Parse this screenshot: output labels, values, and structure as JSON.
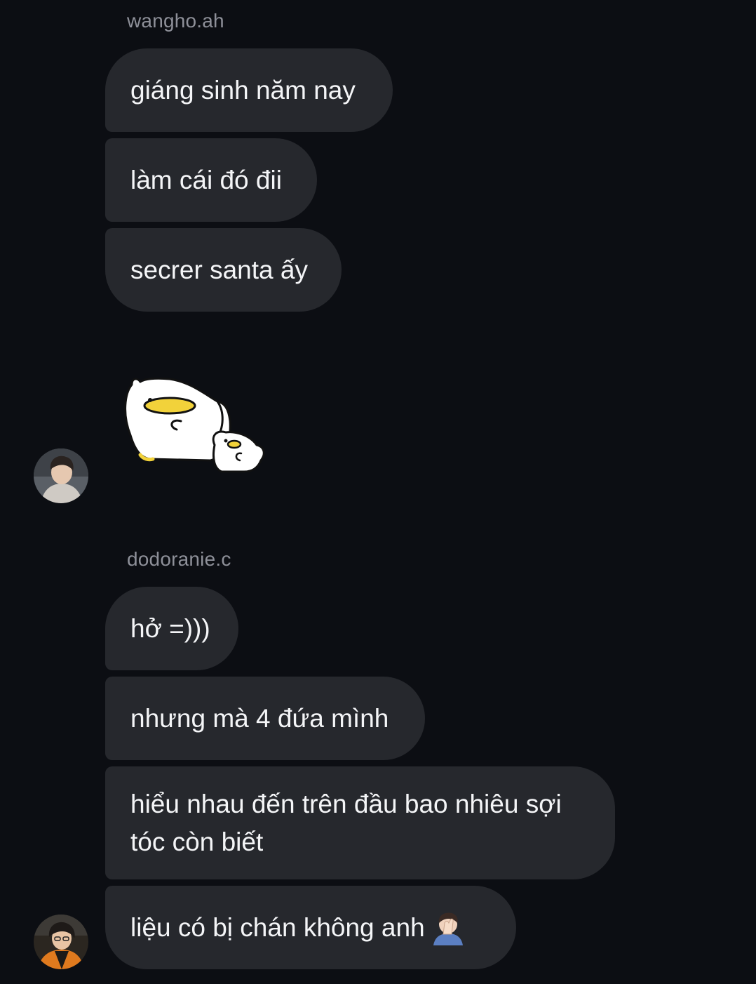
{
  "group1": {
    "sender": "wangho.ah",
    "messages": [
      "giáng sinh năm nay",
      "làm cái đó đii",
      "secrer santa ấy"
    ]
  },
  "group2": {
    "sender": "dodoranie.c",
    "messages": [
      "hở =)))",
      "nhưng mà 4 đứa mình",
      "hiểu nhau đến trên đầu bao nhiêu sợi tóc còn biết",
      "liệu có bị chán không anh"
    ]
  },
  "icons": {
    "sticker": "duck-sticker",
    "facepalm": "facepalm-emoji"
  },
  "colors": {
    "background": "#0c0e13",
    "bubble": "#26282d",
    "sender": "#8e9099",
    "text": "#f4f5f7"
  }
}
